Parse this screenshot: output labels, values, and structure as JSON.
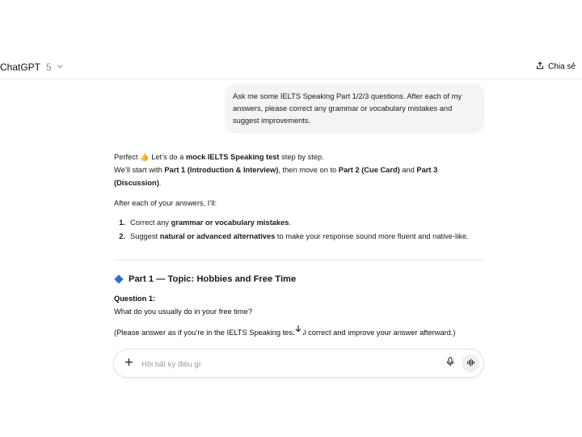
{
  "header": {
    "model_name": "ChatGPT",
    "model_version": "5",
    "share_label": "Chia sẻ"
  },
  "user_message": "Ask me some IELTS Speaking Part 1/2/3 questions. After each of my answers, please correct any grammar or vocabulary mistakes and suggest improvements.",
  "assistant": {
    "intro": {
      "t1": "Perfect ",
      "emoji": "👍",
      "t2": " Let’s do a ",
      "b1": "mock IELTS Speaking test",
      "t3": " step by step."
    },
    "intro2": {
      "t1": "We’ll start with ",
      "b1": "Part 1 (Introduction & Interview)",
      "t2": ", then move on to ",
      "b2": "Part 2 (Cue Card)",
      "t3": " and ",
      "b3": "Part 3 (Discussion)",
      "t4": "."
    },
    "after_answers": "After each of your answers, I’ll:",
    "list": [
      {
        "num": "1.",
        "t1": "Correct any ",
        "b1": "grammar or vocabulary mistakes",
        "t2": "."
      },
      {
        "num": "2.",
        "t1": "Suggest ",
        "b1": "natural or advanced alternatives",
        "t2": " to make your response sound more fluent and native-like."
      }
    ],
    "part_heading": "Part 1 — Topic: Hobbies and Free Time",
    "question_label": "Question 1:",
    "question_text": "What do you usually do in your free time?",
    "note": "(Please answer as if you’re in the IELTS Speaking test. I’ll correct and improve your answer afterward.)"
  },
  "composer": {
    "placeholder": "Hỏi bất kỳ điều gì"
  },
  "icons": {
    "model_chevron": "chevron-down-icon",
    "share": "share-icon",
    "scroll": "arrow-down-icon",
    "plus": "plus-icon",
    "mic": "microphone-icon",
    "voice": "voice-mode-icon"
  },
  "colors": {
    "accent_diamond": "#2b6fd6",
    "bubble_bg": "#f4f4f4"
  }
}
